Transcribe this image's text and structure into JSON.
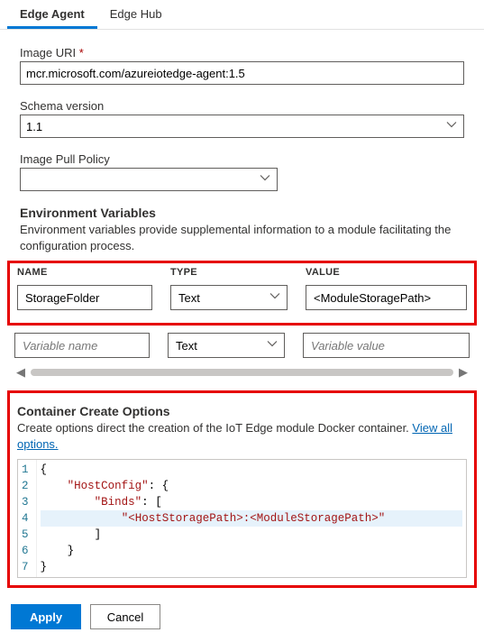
{
  "tabs": {
    "active": "Edge Agent",
    "other": "Edge Hub"
  },
  "fields": {
    "imageUri": {
      "label": "Image URI",
      "value": "mcr.microsoft.com/azureiotedge-agent:1.5"
    },
    "schemaVersion": {
      "label": "Schema version",
      "value": "1.1"
    },
    "pullPolicy": {
      "label": "Image Pull Policy",
      "value": ""
    }
  },
  "envVars": {
    "title": "Environment Variables",
    "desc": "Environment variables provide supplemental information to a module facilitating the configuration process.",
    "headers": {
      "name": "NAME",
      "type": "TYPE",
      "value": "VALUE"
    },
    "rows": [
      {
        "name": "StorageFolder",
        "type": "Text",
        "value": "<ModuleStoragePath>"
      }
    ],
    "placeholders": {
      "name": "Variable name",
      "type": "Text",
      "value": "Variable value"
    }
  },
  "cco": {
    "title": "Container Create Options",
    "desc": "Create options direct the creation of the IoT Edge module Docker container. ",
    "link": "View all options.",
    "code": {
      "lines": [
        "{",
        "    \"HostConfig\": {",
        "        \"Binds\": [",
        "            \"<HostStoragePath>:<ModuleStoragePath>\"",
        "        ]",
        "    }",
        "}"
      ]
    }
  },
  "footer": {
    "apply": "Apply",
    "cancel": "Cancel"
  }
}
